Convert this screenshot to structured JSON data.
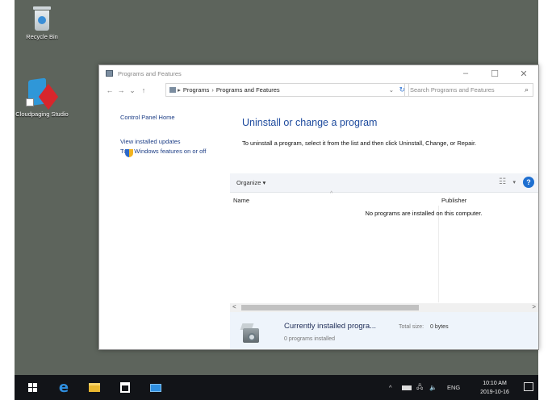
{
  "desktop": {
    "icons": [
      {
        "label": "Recycle Bin"
      },
      {
        "label": "Cloudpaging Studio"
      }
    ]
  },
  "window": {
    "title": "Programs and Features",
    "controls": {
      "minimize": "–",
      "maximize": "☐",
      "close": "✕"
    },
    "nav": {
      "back": "←",
      "forward": "→",
      "recent": "⌄",
      "up": "↑"
    },
    "address": {
      "crumbs": [
        "Programs",
        "Programs and Features"
      ],
      "dropdown": "⌄",
      "refresh": "↻"
    },
    "search": {
      "placeholder": "Search Programs and Features",
      "icon": "⌕"
    }
  },
  "left_pane": {
    "home": "Control Panel Home",
    "updates": "View installed updates",
    "features": "Turn Windows features on or off"
  },
  "main": {
    "heading": "Uninstall or change a program",
    "description": "To uninstall a program, select it from the list and then click Uninstall, Change, or Repair.",
    "toolbar": {
      "organize": "Organize ▾",
      "view_icon": "☷",
      "view_dd": "▾",
      "help": "?"
    },
    "columns": {
      "name": "Name",
      "publisher": "Publisher",
      "sort_caret": "^"
    },
    "empty_message": "No programs are installed on this computer.",
    "scroll": {
      "left": "<",
      "right": ">"
    }
  },
  "details": {
    "title": "Currently installed progra...",
    "total_size_label": "Total size:",
    "total_size": "0 bytes",
    "count": "0 programs installed"
  },
  "taskbar": {
    "tray": {
      "chevron": "^",
      "lang": "ENG",
      "time": "10:10 AM",
      "date": "2019-10-16",
      "volume": "🔈",
      "network": "🖧"
    },
    "edge_glyph": "e"
  }
}
